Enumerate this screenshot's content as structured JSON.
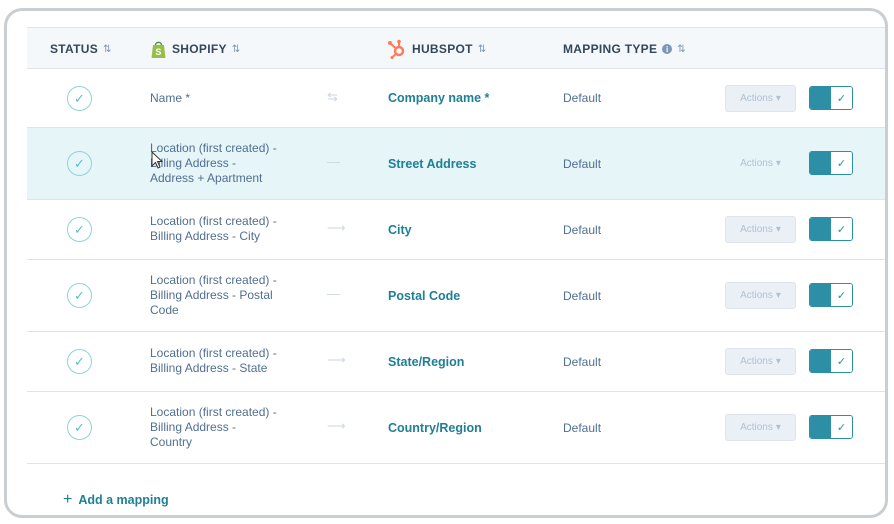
{
  "columns": {
    "status": "STATUS",
    "shopify": "SHOPIFY",
    "hubspot": "HUBSPOT",
    "mapping_type": "MAPPING TYPE",
    "sort_glyph": "⇅",
    "info_glyph": "i"
  },
  "icons": {
    "status": "check-circle-icon",
    "shopify": "shopify-bag-icon",
    "hubspot": "hubspot-sprocket-icon",
    "direction": "sync-arrow-icon"
  },
  "colors": {
    "accent": "#1f7f94",
    "toggle": "#2d8fa6",
    "header_bg": "#f5f8fa",
    "highlight_row": "#e5f5f8",
    "hubspot_orange": "#ff7a59",
    "shopify_green": "#95bf47"
  },
  "rows": [
    {
      "shopify": "Name *",
      "hubspot": "Company name *",
      "type": "Default",
      "arrow": "⇆",
      "actions": "Actions",
      "enabled": true
    },
    {
      "shopify": "Location (first created) -\nBilling Address -\nAddress + Apartment",
      "hubspot": "Street Address",
      "type": "Default",
      "arrow": "—",
      "actions": "Actions",
      "enabled": true
    },
    {
      "shopify": "Location (first created) -\nBilling Address - City",
      "hubspot": "City",
      "type": "Default",
      "arrow": "⟶",
      "actions": "Actions",
      "enabled": true
    },
    {
      "shopify": "Location (first created) -\nBilling Address - Postal\nCode",
      "hubspot": "Postal Code",
      "type": "Default",
      "arrow": "—",
      "actions": "Actions",
      "enabled": true
    },
    {
      "shopify": "Location (first created) -\nBilling Address - State",
      "hubspot": "State/Region",
      "type": "Default",
      "arrow": "⟶",
      "actions": "Actions",
      "enabled": true
    },
    {
      "shopify": "Location (first created) -\nBilling Address -\nCountry",
      "hubspot": "Country/Region",
      "type": "Default",
      "arrow": "⟶",
      "actions": "Actions",
      "enabled": true
    }
  ],
  "footer": {
    "add_mapping": "Add a mapping",
    "plus": "+"
  },
  "glyphs": {
    "check": "✓",
    "caret": "▾"
  }
}
